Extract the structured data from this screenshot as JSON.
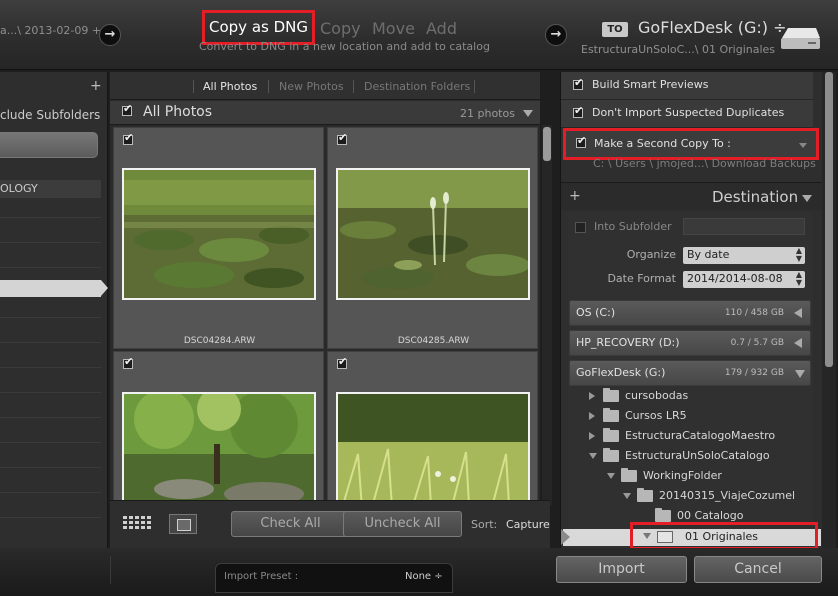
{
  "source": {
    "name": "a...\\ 2013-02-09 +"
  },
  "modes": {
    "copy_as_dng": "Copy as DNG",
    "copy": "Copy",
    "move": "Move",
    "add": "Add",
    "subtitle": "Convert to DNG in a new location and add to catalog"
  },
  "destination_top": {
    "to_label": "TO",
    "drive": "GoFlexDesk (G:) ÷",
    "path": "EstructuraUnSoloC...\\ 01 Originales"
  },
  "left_panel": {
    "include_subfolders": "clude Subfolders",
    "catalog_label": "OLOGY"
  },
  "tabs": {
    "all_photos": "All Photos",
    "new_photos": "New Photos",
    "destination_folders": "Destination Folders"
  },
  "grid": {
    "title": "All Photos",
    "count": "21 photos",
    "photos": [
      {
        "filename": "DSC04284.ARW",
        "checked": true
      },
      {
        "filename": "DSC04285.ARW",
        "checked": true
      },
      {
        "filename": "",
        "checked": true
      },
      {
        "filename": "",
        "checked": true
      }
    ]
  },
  "toolbar": {
    "check_all": "Check All",
    "uncheck_all": "Uncheck All",
    "sort_label": "Sort:",
    "sort_value": "Capture Time"
  },
  "options": {
    "build_smart_previews": "Build Smart Previews",
    "dont_import_duplicates": "Don't Import Suspected Duplicates",
    "second_copy": "Make a Second Copy To :",
    "second_copy_path": "C: \\ Users \\ jmojed...\\ Download Backups"
  },
  "destination": {
    "header": "Destination",
    "into_subfolder": "Into Subfolder",
    "organize_label": "Organize",
    "organize_value": "By date",
    "date_format_label": "Date Format",
    "date_format_value": "2014/2014-08-08",
    "volumes": [
      {
        "name": "OS (C:)",
        "size": "110 / 458 GB"
      },
      {
        "name": "HP_RECOVERY (D:)",
        "size": "0.7 / 5.7 GB"
      },
      {
        "name": "GoFlexDesk (G:)",
        "size": "179 / 932 GB"
      }
    ],
    "folders": [
      "cursobodas",
      "Cursos LR5",
      "EstructuraCatalogoMaestro",
      "EstructuraUnSoloCatalogo",
      "WorkingFolder",
      "20140315_ViajeCozumel",
      "00 Catalogo",
      "01 Originales"
    ]
  },
  "footer": {
    "import_preset_label": "Import Preset :",
    "import_preset_value": "None ÷",
    "import": "Import",
    "cancel": "Cancel"
  },
  "colors": {
    "highlight": "#e41e26",
    "panel": "#2e2e2e"
  }
}
